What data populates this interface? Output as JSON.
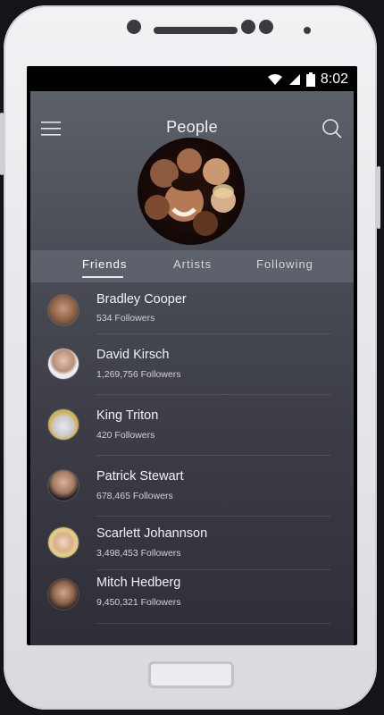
{
  "status_bar": {
    "time": "8:02",
    "icons": [
      "wifi-icon",
      "signal-icon",
      "battery-icon"
    ]
  },
  "header": {
    "title": "People",
    "menu_icon": "hamburger-menu-icon",
    "search_icon": "search-icon"
  },
  "tabs": [
    {
      "label": "Friends",
      "active": true
    },
    {
      "label": "Artists",
      "active": false
    },
    {
      "label": "Following",
      "active": false
    }
  ],
  "people": [
    {
      "name": "Bradley Cooper",
      "followers": "534 Followers"
    },
    {
      "name": "David Kirsch",
      "followers": "1,269,756 Followers"
    },
    {
      "name": "King Triton",
      "followers": "420 Followers"
    },
    {
      "name": "Patrick Stewart",
      "followers": "678,465 Followers"
    },
    {
      "name": "Scarlett Johannson",
      "followers": "3,498,453 Followers"
    },
    {
      "name": "Mitch Hedberg",
      "followers": "9,450,321 Followers"
    }
  ],
  "colors": {
    "accent": "#ffffff",
    "text_secondary": "#d0d2d8",
    "background_top": "#5c6068",
    "background_bottom": "#2f2e38"
  }
}
